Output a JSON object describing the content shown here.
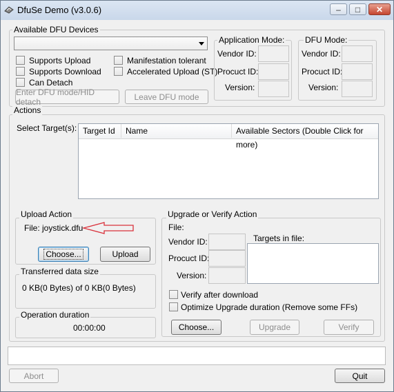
{
  "window": {
    "title": "DfuSe Demo (v3.0.6)",
    "controls": {
      "minimize": "–",
      "maximize": "□",
      "close": "✕"
    }
  },
  "devices": {
    "group_label": "Available DFU Devices",
    "dropdown_value": "",
    "checkboxes": {
      "supports_upload": "Supports Upload",
      "supports_download": "Supports Download",
      "can_detach": "Can Detach",
      "manifestation_tolerant": "Manifestation tolerant",
      "accelerated_upload": "Accelerated Upload (ST)"
    },
    "enter_dfu_button": "Enter DFU mode/HID detach",
    "leave_dfu_button": "Leave DFU mode"
  },
  "app_mode": {
    "label": "Application Mode:",
    "vendor_id": "Vendor ID:",
    "product_id": "Procuct ID:",
    "version": "Version:"
  },
  "dfu_mode": {
    "label": "DFU Mode:",
    "vendor_id": "Vendor ID:",
    "product_id": "Procuct ID:",
    "version": "Version:"
  },
  "actions": {
    "group_label": "Actions",
    "select_targets": "Select Target(s):",
    "columns": [
      "Target Id",
      "Name",
      "Available Sectors (Double Click for more)"
    ]
  },
  "upload": {
    "group_label": "Upload Action",
    "file_label": "File:",
    "file_value": "joystick.dfu",
    "choose_button": "Choose...",
    "upload_button": "Upload"
  },
  "transferred": {
    "group_label": "Transferred data size",
    "value": "0 KB(0 Bytes) of 0 KB(0 Bytes)"
  },
  "duration": {
    "group_label": "Operation duration",
    "value": "00:00:00"
  },
  "upgrade": {
    "group_label": "Upgrade or Verify Action",
    "file_label": "File:",
    "vendor_id": "Vendor ID:",
    "product_id": "Procuct ID:",
    "version": "Version:",
    "targets_in_file": "Targets in file:",
    "verify_after_download": "Verify after download",
    "optimize_upgrade": "Optimize Upgrade duration (Remove some FFs)",
    "choose_button": "Choose...",
    "upgrade_button": "Upgrade",
    "verify_button": "Verify"
  },
  "footer": {
    "abort_button": "Abort",
    "quit_button": "Quit"
  },
  "colors": {
    "annotation_arrow": "#d9303a"
  }
}
